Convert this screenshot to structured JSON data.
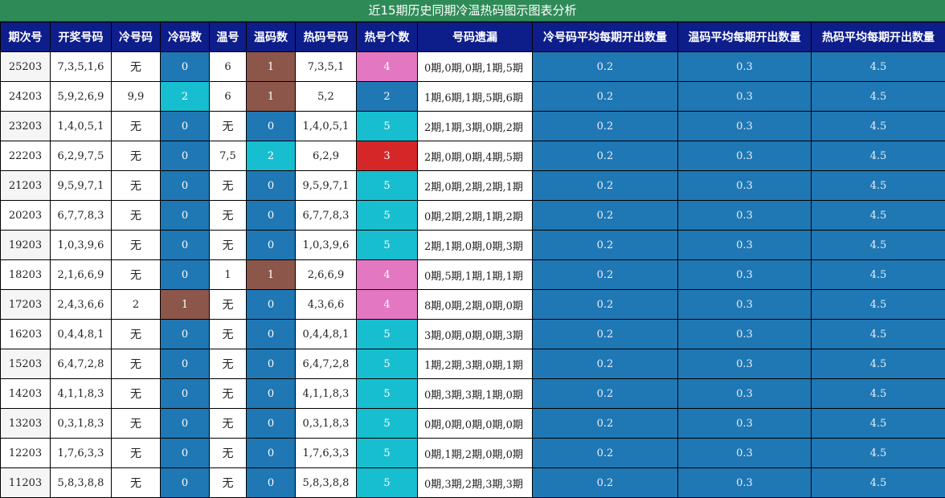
{
  "title": "近15期历史同期冷温热码图示图表分析",
  "headers": [
    "期次号",
    "开奖号码",
    "冷号码",
    "冷码数",
    "温号",
    "温码数",
    "热码号码",
    "热号个数",
    "号码遗漏",
    "冷号码平均每期开出数量",
    "温码平均每期开出数量",
    "热码平均每期开出数量"
  ],
  "averages": {
    "cold": "0.2",
    "warm": "0.3",
    "hot": "4.5"
  },
  "colors": {
    "title_bg": "#2e8b57",
    "header_bg": "#0d1d8a",
    "blue": "#1f77b4",
    "cyan": "#17becf",
    "brown": "#8c564b",
    "pink": "#e377c2",
    "red": "#d62728"
  },
  "rows": [
    {
      "issue": "25203",
      "draw": "7,3,5,1,6",
      "cold": "无",
      "cold_count": "0",
      "warm": "6",
      "warm_count": "1",
      "hot": "7,3,5,1",
      "hot_count": "4",
      "missing": "0期,0期,0期,1期,5期"
    },
    {
      "issue": "24203",
      "draw": "5,9,2,6,9",
      "cold": "9,9",
      "cold_count": "2",
      "warm": "6",
      "warm_count": "1",
      "hot": "5,2",
      "hot_count": "2",
      "missing": "1期,6期,1期,5期,6期"
    },
    {
      "issue": "23203",
      "draw": "1,4,0,5,1",
      "cold": "无",
      "cold_count": "0",
      "warm": "无",
      "warm_count": "0",
      "hot": "1,4,0,5,1",
      "hot_count": "5",
      "missing": "2期,1期,3期,0期,2期"
    },
    {
      "issue": "22203",
      "draw": "6,2,9,7,5",
      "cold": "无",
      "cold_count": "0",
      "warm": "7,5",
      "warm_count": "2",
      "hot": "6,2,9",
      "hot_count": "3",
      "missing": "2期,0期,0期,4期,5期"
    },
    {
      "issue": "21203",
      "draw": "9,5,9,7,1",
      "cold": "无",
      "cold_count": "0",
      "warm": "无",
      "warm_count": "0",
      "hot": "9,5,9,7,1",
      "hot_count": "5",
      "missing": "2期,0期,2期,2期,1期"
    },
    {
      "issue": "20203",
      "draw": "6,7,7,8,3",
      "cold": "无",
      "cold_count": "0",
      "warm": "无",
      "warm_count": "0",
      "hot": "6,7,7,8,3",
      "hot_count": "5",
      "missing": "0期,2期,2期,1期,2期"
    },
    {
      "issue": "19203",
      "draw": "1,0,3,9,6",
      "cold": "无",
      "cold_count": "0",
      "warm": "无",
      "warm_count": "0",
      "hot": "1,0,3,9,6",
      "hot_count": "5",
      "missing": "2期,1期,0期,0期,3期"
    },
    {
      "issue": "18203",
      "draw": "2,1,6,6,9",
      "cold": "无",
      "cold_count": "0",
      "warm": "1",
      "warm_count": "1",
      "hot": "2,6,6,9",
      "hot_count": "4",
      "missing": "0期,5期,1期,1期,1期"
    },
    {
      "issue": "17203",
      "draw": "2,4,3,6,6",
      "cold": "2",
      "cold_count": "1",
      "warm": "无",
      "warm_count": "0",
      "hot": "4,3,6,6",
      "hot_count": "4",
      "missing": "8期,0期,2期,0期,0期"
    },
    {
      "issue": "16203",
      "draw": "0,4,4,8,1",
      "cold": "无",
      "cold_count": "0",
      "warm": "无",
      "warm_count": "0",
      "hot": "0,4,4,8,1",
      "hot_count": "5",
      "missing": "3期,0期,0期,0期,3期"
    },
    {
      "issue": "15203",
      "draw": "6,4,7,2,8",
      "cold": "无",
      "cold_count": "0",
      "warm": "无",
      "warm_count": "0",
      "hot": "6,4,7,2,8",
      "hot_count": "5",
      "missing": "1期,2期,3期,0期,1期"
    },
    {
      "issue": "14203",
      "draw": "4,1,1,8,3",
      "cold": "无",
      "cold_count": "0",
      "warm": "无",
      "warm_count": "0",
      "hot": "4,1,1,8,3",
      "hot_count": "5",
      "missing": "0期,3期,3期,1期,0期"
    },
    {
      "issue": "13203",
      "draw": "0,3,1,8,3",
      "cold": "无",
      "cold_count": "0",
      "warm": "无",
      "warm_count": "0",
      "hot": "0,3,1,8,3",
      "hot_count": "5",
      "missing": "0期,0期,0期,0期,0期"
    },
    {
      "issue": "12203",
      "draw": "1,7,6,3,3",
      "cold": "无",
      "cold_count": "0",
      "warm": "无",
      "warm_count": "0",
      "hot": "1,7,6,3,3",
      "hot_count": "5",
      "missing": "0期,1期,2期,0期,0期"
    },
    {
      "issue": "11203",
      "draw": "5,8,3,8,8",
      "cold": "无",
      "cold_count": "0",
      "warm": "无",
      "warm_count": "0",
      "hot": "5,8,3,8,8",
      "hot_count": "5",
      "missing": "0期,3期,2期,3期,3期"
    }
  ]
}
